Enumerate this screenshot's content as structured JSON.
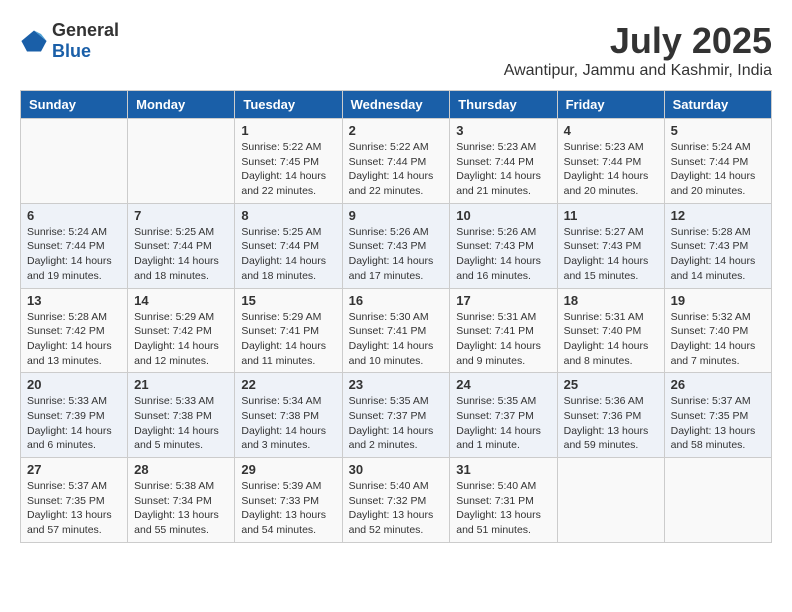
{
  "header": {
    "logo_general": "General",
    "logo_blue": "Blue",
    "month": "July 2025",
    "location": "Awantipur, Jammu and Kashmir, India"
  },
  "weekdays": [
    "Sunday",
    "Monday",
    "Tuesday",
    "Wednesday",
    "Thursday",
    "Friday",
    "Saturday"
  ],
  "weeks": [
    [
      {
        "day": "",
        "info": ""
      },
      {
        "day": "",
        "info": ""
      },
      {
        "day": "1",
        "info": "Sunrise: 5:22 AM\nSunset: 7:45 PM\nDaylight: 14 hours and 22 minutes."
      },
      {
        "day": "2",
        "info": "Sunrise: 5:22 AM\nSunset: 7:44 PM\nDaylight: 14 hours and 22 minutes."
      },
      {
        "day": "3",
        "info": "Sunrise: 5:23 AM\nSunset: 7:44 PM\nDaylight: 14 hours and 21 minutes."
      },
      {
        "day": "4",
        "info": "Sunrise: 5:23 AM\nSunset: 7:44 PM\nDaylight: 14 hours and 20 minutes."
      },
      {
        "day": "5",
        "info": "Sunrise: 5:24 AM\nSunset: 7:44 PM\nDaylight: 14 hours and 20 minutes."
      }
    ],
    [
      {
        "day": "6",
        "info": "Sunrise: 5:24 AM\nSunset: 7:44 PM\nDaylight: 14 hours and 19 minutes."
      },
      {
        "day": "7",
        "info": "Sunrise: 5:25 AM\nSunset: 7:44 PM\nDaylight: 14 hours and 18 minutes."
      },
      {
        "day": "8",
        "info": "Sunrise: 5:25 AM\nSunset: 7:44 PM\nDaylight: 14 hours and 18 minutes."
      },
      {
        "day": "9",
        "info": "Sunrise: 5:26 AM\nSunset: 7:43 PM\nDaylight: 14 hours and 17 minutes."
      },
      {
        "day": "10",
        "info": "Sunrise: 5:26 AM\nSunset: 7:43 PM\nDaylight: 14 hours and 16 minutes."
      },
      {
        "day": "11",
        "info": "Sunrise: 5:27 AM\nSunset: 7:43 PM\nDaylight: 14 hours and 15 minutes."
      },
      {
        "day": "12",
        "info": "Sunrise: 5:28 AM\nSunset: 7:43 PM\nDaylight: 14 hours and 14 minutes."
      }
    ],
    [
      {
        "day": "13",
        "info": "Sunrise: 5:28 AM\nSunset: 7:42 PM\nDaylight: 14 hours and 13 minutes."
      },
      {
        "day": "14",
        "info": "Sunrise: 5:29 AM\nSunset: 7:42 PM\nDaylight: 14 hours and 12 minutes."
      },
      {
        "day": "15",
        "info": "Sunrise: 5:29 AM\nSunset: 7:41 PM\nDaylight: 14 hours and 11 minutes."
      },
      {
        "day": "16",
        "info": "Sunrise: 5:30 AM\nSunset: 7:41 PM\nDaylight: 14 hours and 10 minutes."
      },
      {
        "day": "17",
        "info": "Sunrise: 5:31 AM\nSunset: 7:41 PM\nDaylight: 14 hours and 9 minutes."
      },
      {
        "day": "18",
        "info": "Sunrise: 5:31 AM\nSunset: 7:40 PM\nDaylight: 14 hours and 8 minutes."
      },
      {
        "day": "19",
        "info": "Sunrise: 5:32 AM\nSunset: 7:40 PM\nDaylight: 14 hours and 7 minutes."
      }
    ],
    [
      {
        "day": "20",
        "info": "Sunrise: 5:33 AM\nSunset: 7:39 PM\nDaylight: 14 hours and 6 minutes."
      },
      {
        "day": "21",
        "info": "Sunrise: 5:33 AM\nSunset: 7:38 PM\nDaylight: 14 hours and 5 minutes."
      },
      {
        "day": "22",
        "info": "Sunrise: 5:34 AM\nSunset: 7:38 PM\nDaylight: 14 hours and 3 minutes."
      },
      {
        "day": "23",
        "info": "Sunrise: 5:35 AM\nSunset: 7:37 PM\nDaylight: 14 hours and 2 minutes."
      },
      {
        "day": "24",
        "info": "Sunrise: 5:35 AM\nSunset: 7:37 PM\nDaylight: 14 hours and 1 minute."
      },
      {
        "day": "25",
        "info": "Sunrise: 5:36 AM\nSunset: 7:36 PM\nDaylight: 13 hours and 59 minutes."
      },
      {
        "day": "26",
        "info": "Sunrise: 5:37 AM\nSunset: 7:35 PM\nDaylight: 13 hours and 58 minutes."
      }
    ],
    [
      {
        "day": "27",
        "info": "Sunrise: 5:37 AM\nSunset: 7:35 PM\nDaylight: 13 hours and 57 minutes."
      },
      {
        "day": "28",
        "info": "Sunrise: 5:38 AM\nSunset: 7:34 PM\nDaylight: 13 hours and 55 minutes."
      },
      {
        "day": "29",
        "info": "Sunrise: 5:39 AM\nSunset: 7:33 PM\nDaylight: 13 hours and 54 minutes."
      },
      {
        "day": "30",
        "info": "Sunrise: 5:40 AM\nSunset: 7:32 PM\nDaylight: 13 hours and 52 minutes."
      },
      {
        "day": "31",
        "info": "Sunrise: 5:40 AM\nSunset: 7:31 PM\nDaylight: 13 hours and 51 minutes."
      },
      {
        "day": "",
        "info": ""
      },
      {
        "day": "",
        "info": ""
      }
    ]
  ]
}
